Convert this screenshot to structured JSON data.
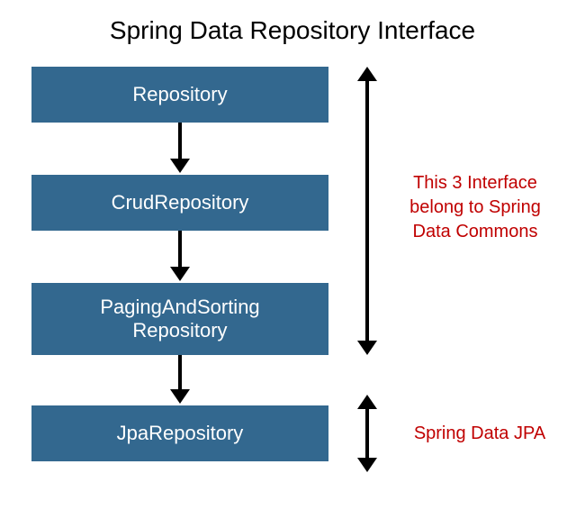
{
  "title": "Spring Data Repository Interface",
  "boxes": [
    {
      "label": "Repository"
    },
    {
      "label": "CrudRepository"
    },
    {
      "label": "PagingAndSorting\nRepository"
    },
    {
      "label": "JpaRepository"
    }
  ],
  "annotations": {
    "commons": "This 3 Interface\nbelong to Spring\nData Commons",
    "jpa": "Spring Data JPA"
  },
  "colors": {
    "box_bg": "#33688f",
    "box_text": "#ffffff",
    "annotation_text": "#c00000"
  }
}
